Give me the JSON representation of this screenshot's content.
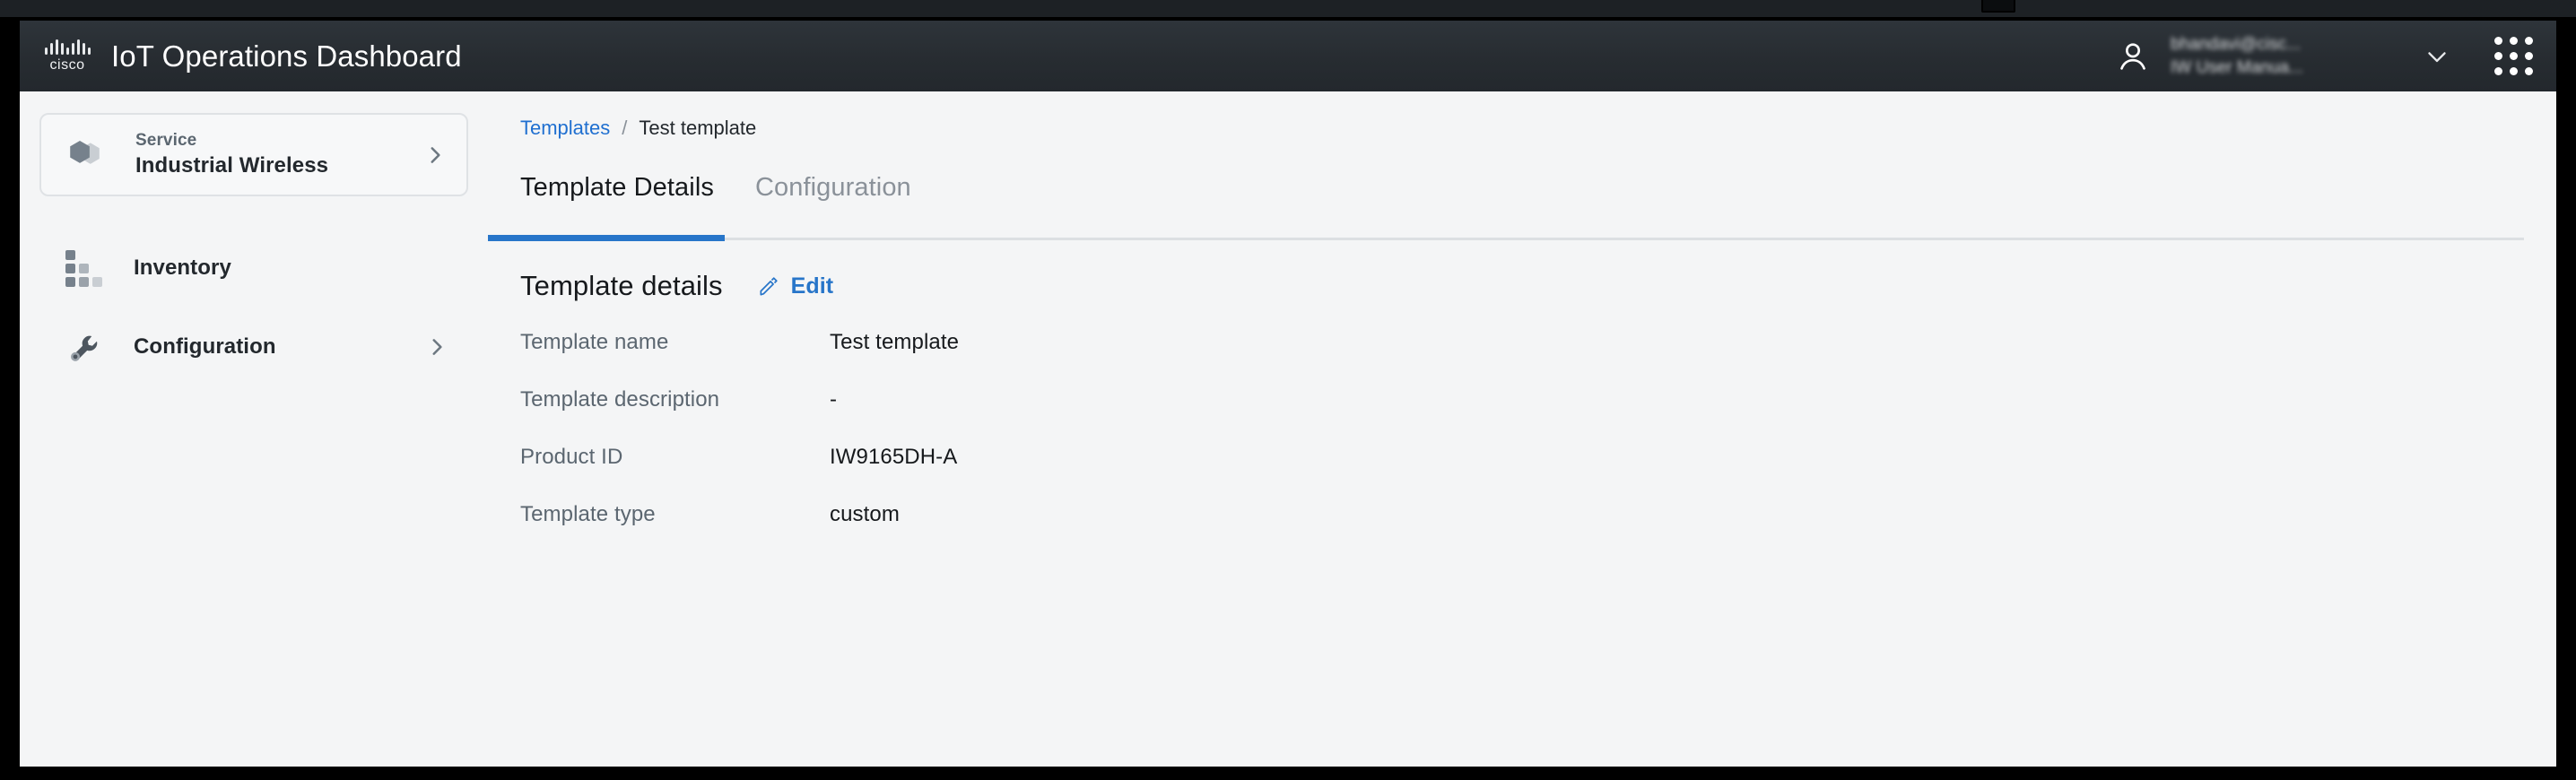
{
  "header": {
    "brand_wordmark": "cisco",
    "app_title": "IoT Operations Dashboard",
    "user_email": "bhandavi@cisc...",
    "user_org": "IW User Manua...",
    "avatar_icon": "user-icon",
    "chevron_icon": "chevron-down-icon",
    "apps_icon": "app-grid-icon"
  },
  "sidebar": {
    "service": {
      "label": "Service",
      "value": "Industrial Wireless",
      "icon": "hexagon-service-icon",
      "chevron": "chevron-right-icon"
    },
    "items": [
      {
        "label": "Inventory",
        "icon": "inventory-grid-icon",
        "chevron": ""
      },
      {
        "label": "Configuration",
        "icon": "wrench-icon",
        "chevron": "chevron-right-icon"
      }
    ]
  },
  "content": {
    "breadcrumb": {
      "root": "Templates",
      "separator": "/",
      "current": "Test template"
    },
    "tabs": [
      {
        "label": "Template Details",
        "active": true
      },
      {
        "label": "Configuration",
        "active": false
      }
    ],
    "details": {
      "title": "Template details",
      "edit_label": "Edit",
      "edit_icon": "pencil-icon",
      "rows": [
        {
          "key": "Template name",
          "value": "Test template"
        },
        {
          "key": "Template description",
          "value": "-"
        },
        {
          "key": "Product ID",
          "value": "IW9165DH-A"
        },
        {
          "key": "Template type",
          "value": "custom"
        }
      ]
    }
  },
  "colors": {
    "header_bg": "#272c31",
    "content_bg": "#f4f5f6",
    "accent_blue": "#2775c9",
    "link_blue": "#1f6fd0",
    "muted_text": "#5b6670",
    "primary_text": "#16191c"
  }
}
